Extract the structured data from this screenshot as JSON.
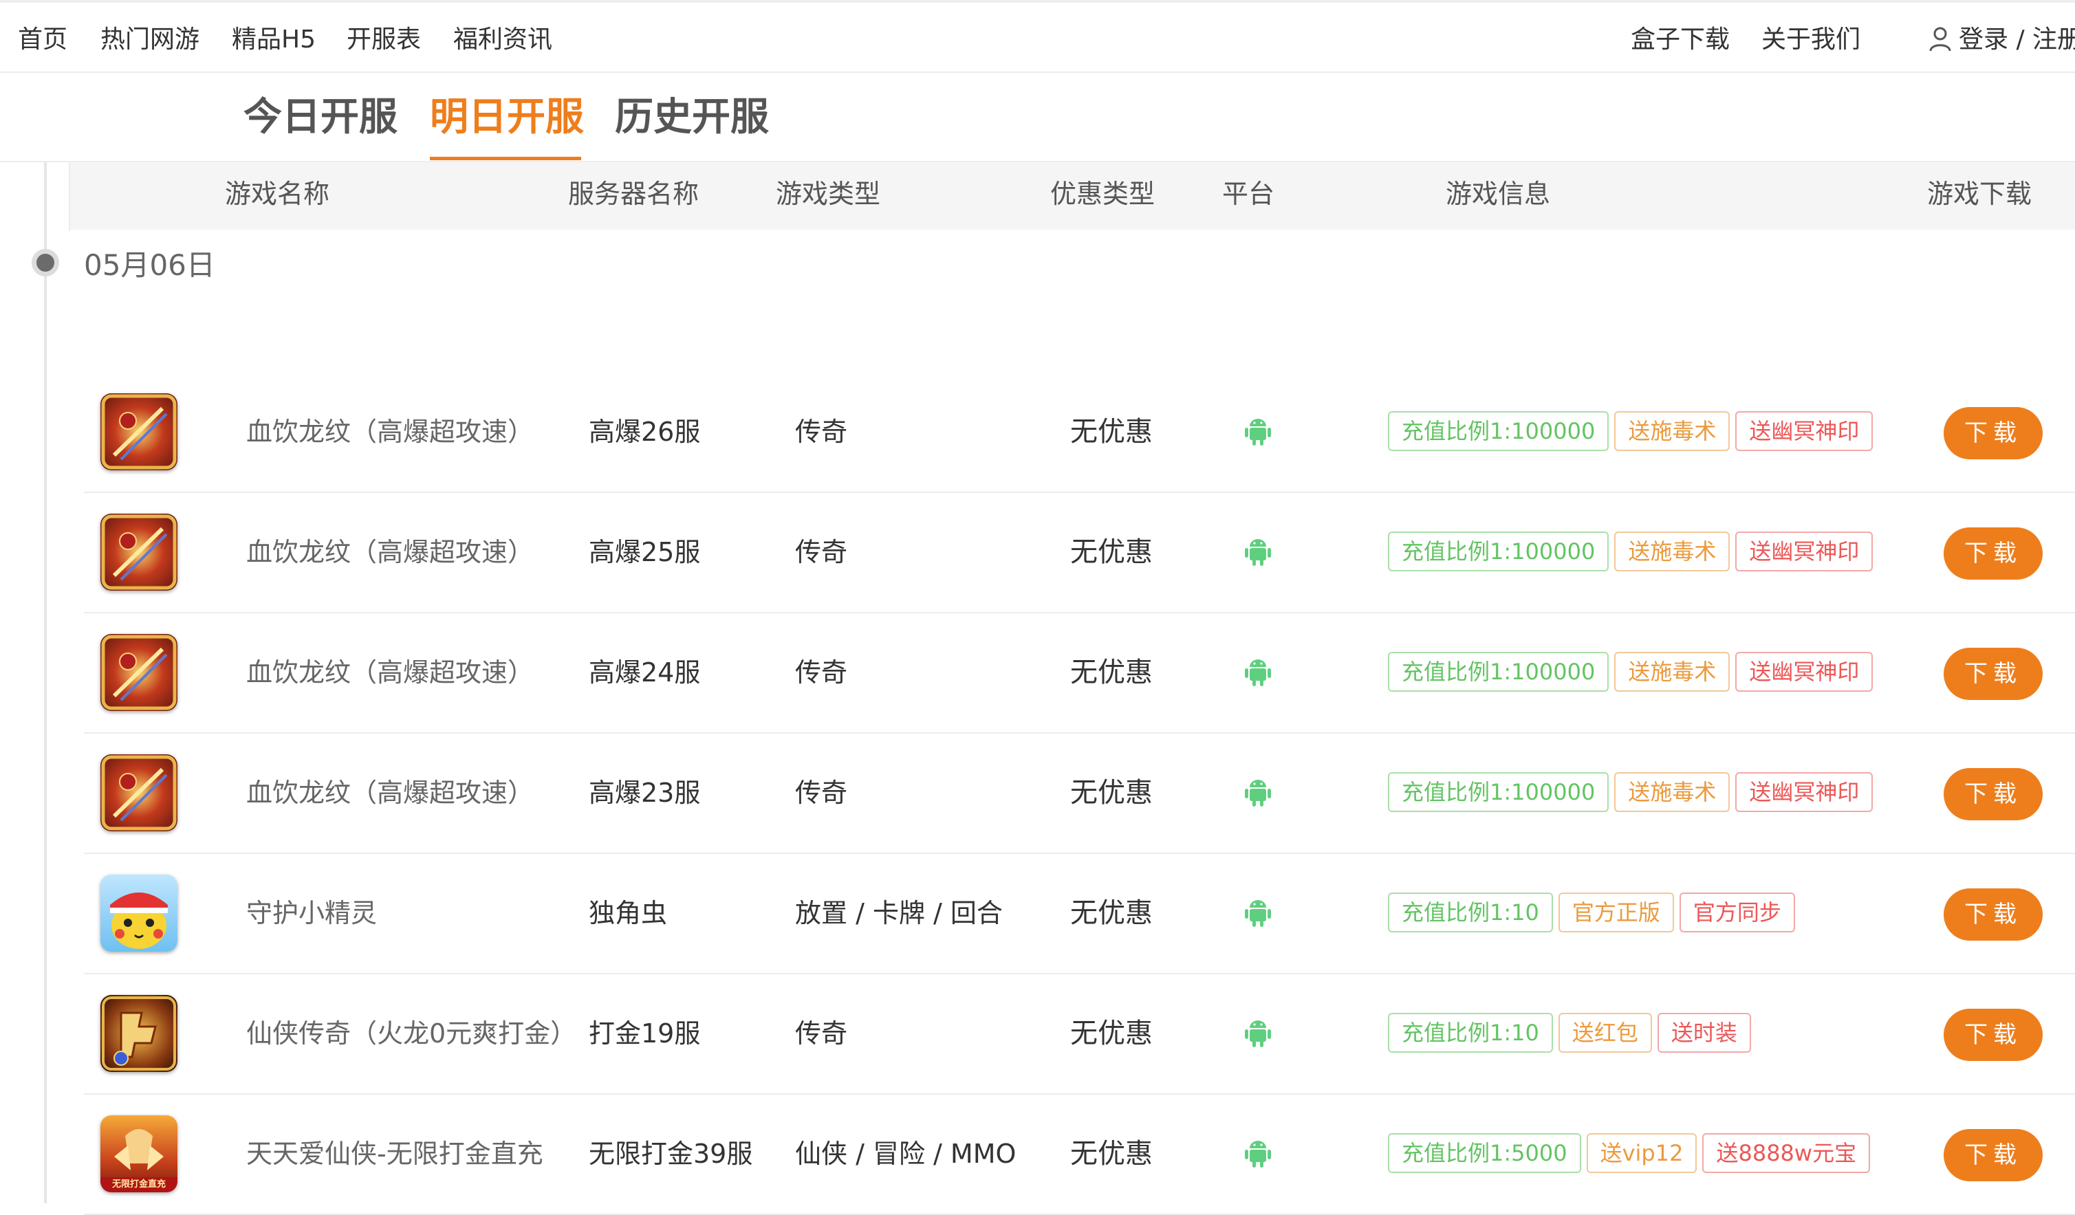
{
  "nav": {
    "left": [
      "首页",
      "热门网游",
      "精品H5",
      "开服表",
      "福利资讯"
    ],
    "right": [
      "盒子下载",
      "关于我们"
    ],
    "login": "登录 / 注册"
  },
  "tabs": [
    "今日开服",
    "明日开服",
    "历史开服"
  ],
  "active_tab": "明日开服",
  "columns": [
    "游戏名称",
    "服务器名称",
    "游戏类型",
    "优惠类型",
    "平台",
    "游戏信息",
    "游戏下载"
  ],
  "date": "05月06日",
  "download_label": "下载",
  "rows": [
    {
      "name": "血饮龙纹（高爆超攻速）",
      "server": "高爆26服",
      "type": "传奇",
      "discount": "无优惠",
      "platform": "android",
      "tags": [
        "充值比例1:100000",
        "送施毒术",
        "送幽冥神印"
      ],
      "icon": "xueyin"
    },
    {
      "name": "血饮龙纹（高爆超攻速）",
      "server": "高爆25服",
      "type": "传奇",
      "discount": "无优惠",
      "platform": "android",
      "tags": [
        "充值比例1:100000",
        "送施毒术",
        "送幽冥神印"
      ],
      "icon": "xueyin"
    },
    {
      "name": "血饮龙纹（高爆超攻速）",
      "server": "高爆24服",
      "type": "传奇",
      "discount": "无优惠",
      "platform": "android",
      "tags": [
        "充值比例1:100000",
        "送施毒术",
        "送幽冥神印"
      ],
      "icon": "xueyin"
    },
    {
      "name": "血饮龙纹（高爆超攻速）",
      "server": "高爆23服",
      "type": "传奇",
      "discount": "无优惠",
      "platform": "android",
      "tags": [
        "充值比例1:100000",
        "送施毒术",
        "送幽冥神印"
      ],
      "icon": "xueyin"
    },
    {
      "name": "守护小精灵",
      "server": "独角虫",
      "type": "放置 / 卡牌 / 回合",
      "discount": "无优惠",
      "platform": "android",
      "tags": [
        "充值比例1:10",
        "官方正版",
        "官方同步"
      ],
      "icon": "pikachu"
    },
    {
      "name": "仙侠传奇（火龙0元爽打金）",
      "server": "打金19服",
      "type": "传奇",
      "discount": "无优惠",
      "platform": "android",
      "tags": [
        "充值比例1:10",
        "送红包",
        "送时装"
      ],
      "icon": "chuanqi"
    },
    {
      "name": "天天爱仙侠-无限打金直充",
      "server": "无限打金39服",
      "type": "仙侠 / 冒险 / MMO",
      "discount": "无优惠",
      "platform": "android",
      "tags": [
        "充值比例1:5000",
        "送vip12",
        "送8888w元宝"
      ],
      "icon": "xianxia",
      "icon_text": "无限打金直充"
    }
  ],
  "colors": {
    "accent": "#ee7e1c",
    "android": "#5ecf7f",
    "tag_green": "#62c462",
    "tag_orange": "#eb9a3c",
    "tag_red": "#ec5757"
  }
}
